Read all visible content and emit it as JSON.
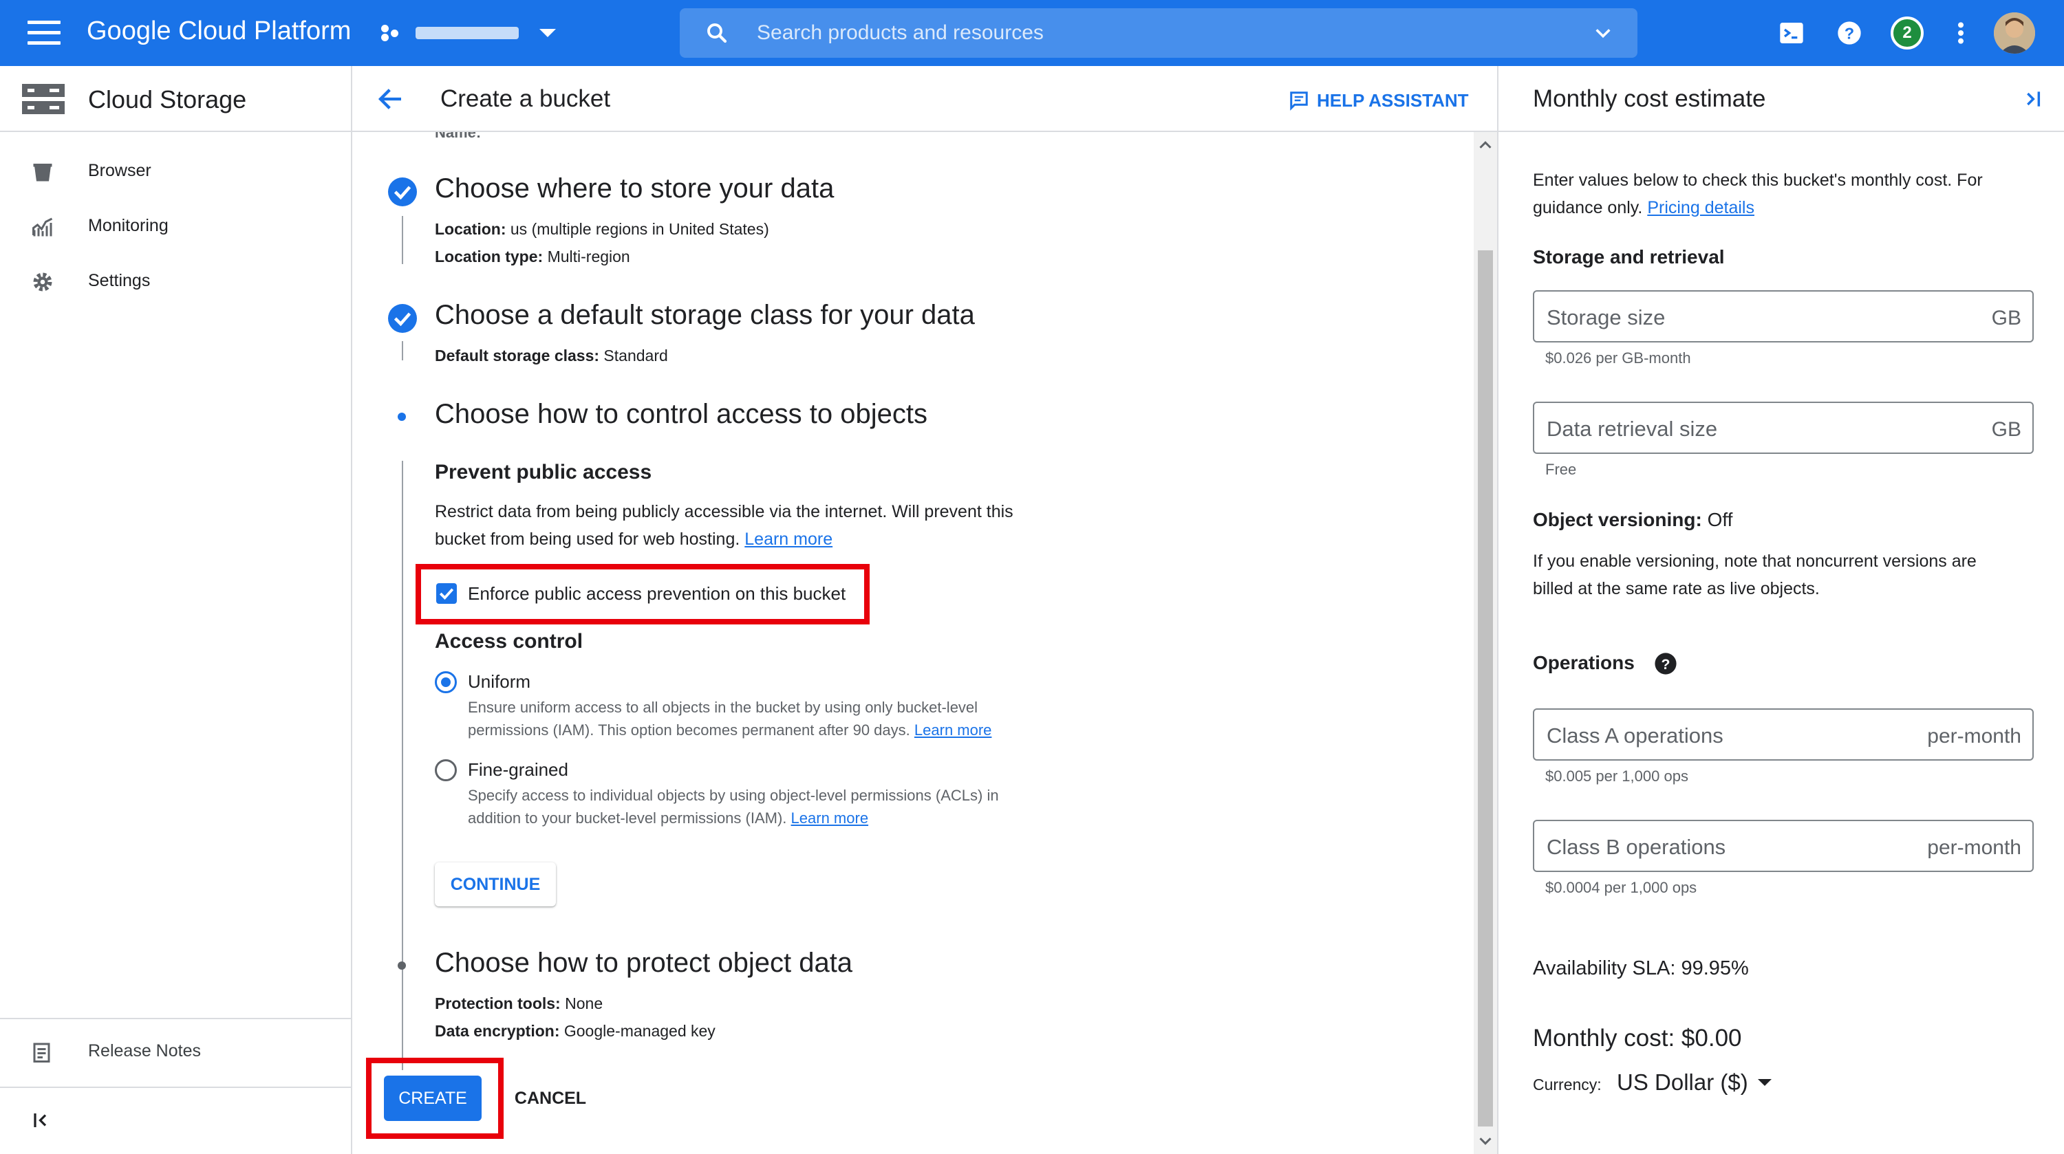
{
  "topbar": {
    "brand": "Google Cloud Platform",
    "search_placeholder": "Search products and resources",
    "notification_count": "2"
  },
  "leftnav": {
    "title": "Cloud Storage",
    "items": [
      {
        "label": "Browser",
        "icon": "bucket-icon"
      },
      {
        "label": "Monitoring",
        "icon": "chart-icon"
      },
      {
        "label": "Settings",
        "icon": "gear-icon"
      }
    ],
    "release_notes": "Release Notes"
  },
  "main": {
    "title": "Create a bucket",
    "help_assistant": "HELP ASSISTANT",
    "name_line": {
      "label": "Name:",
      "value": ""
    },
    "step_location": {
      "title": "Choose where to store your data",
      "location_label": "Location:",
      "location_value": "us (multiple regions in United States)",
      "type_label": "Location type:",
      "type_value": "Multi-region"
    },
    "step_class": {
      "title": "Choose a default storage class for your data",
      "class_label": "Default storage class:",
      "class_value": "Standard"
    },
    "step_access": {
      "title": "Choose how to control access to objects",
      "prevent_title": "Prevent public access",
      "prevent_desc_1": "Restrict data from being publicly accessible via the internet. Will prevent this",
      "prevent_desc_2": "bucket from being used for web hosting.",
      "learn_more": "Learn more",
      "enforce_label": "Enforce public access prevention on this bucket",
      "access_control_title": "Access control",
      "uniform_label": "Uniform",
      "uniform_desc_1": "Ensure uniform access to all objects in the bucket by using only bucket-level",
      "uniform_desc_2": "permissions (IAM). This option becomes permanent after 90 days.",
      "fine_label": "Fine-grained",
      "fine_desc_1": "Specify access to individual objects by using object-level permissions (ACLs) in",
      "fine_desc_2": "addition to your bucket-level permissions (IAM).",
      "continue": "CONTINUE"
    },
    "step_protect": {
      "title": "Choose how to protect object data",
      "tools_label": "Protection tools:",
      "tools_value": "None",
      "enc_label": "Data encryption:",
      "enc_value": "Google-managed key"
    },
    "create": "CREATE",
    "cancel": "CANCEL"
  },
  "right": {
    "title": "Monthly cost estimate",
    "intro_1": "Enter values below to check this bucket's monthly cost. For",
    "intro_2": "guidance only.",
    "pricing_link": "Pricing details",
    "storage_title": "Storage and retrieval",
    "storage_size_placeholder": "Storage size",
    "storage_unit": "GB",
    "storage_hint": "$0.026 per GB-month",
    "retrieval_placeholder": "Data retrieval size",
    "retrieval_unit": "GB",
    "retrieval_hint": "Free",
    "versioning_label": "Object versioning:",
    "versioning_value": "Off",
    "versioning_desc_1": "If you enable versioning, note that noncurrent versions are",
    "versioning_desc_2": "billed at the same rate as live objects.",
    "operations_title": "Operations",
    "class_a_placeholder": "Class A operations",
    "class_a_unit": "per-month",
    "class_a_hint": "$0.005 per 1,000 ops",
    "class_b_placeholder": "Class B operations",
    "class_b_unit": "per-month",
    "class_b_hint": "$0.0004 per 1,000 ops",
    "sla": "Availability SLA: 99.95%",
    "monthly_cost": "Monthly cost: $0.00",
    "currency_label": "Currency:",
    "currency_value": "US Dollar ($)"
  },
  "colors": {
    "accent": "#1a73e8",
    "highlight_box": "#e8000b",
    "badge_green": "#1e8e3e"
  }
}
